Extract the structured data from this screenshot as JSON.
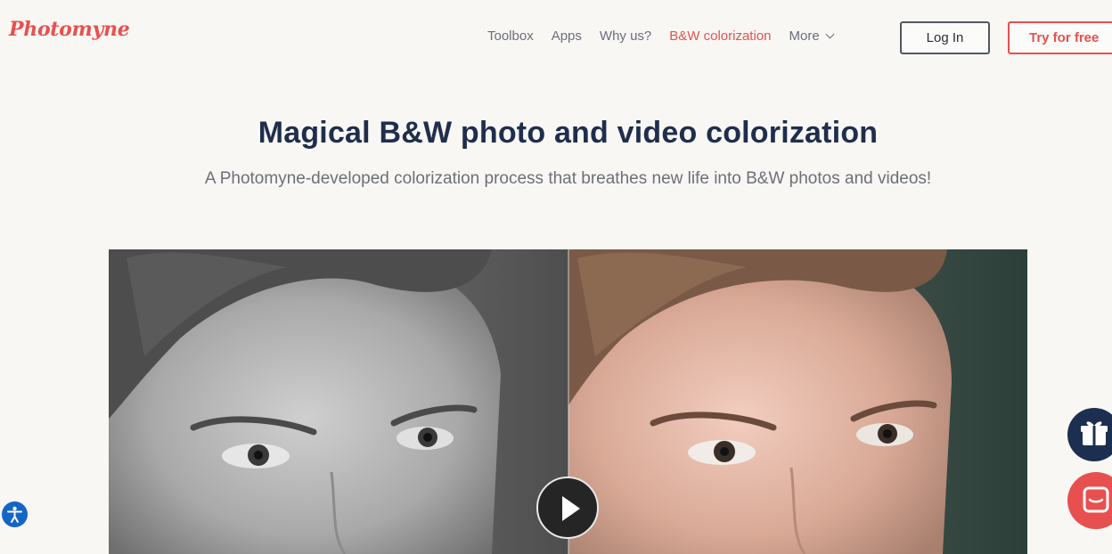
{
  "header": {
    "logo": "Photomyne",
    "nav": {
      "toolbox": "Toolbox",
      "apps": "Apps",
      "why_us": "Why us?",
      "colorization": "B&W colorization",
      "more": "More"
    },
    "login_label": "Log In",
    "try_label": "Try for free"
  },
  "hero": {
    "title": "Magical B&W photo and video colorization",
    "subtitle": "A Photomyne-developed colorization process that breathes new life into B&W photos and videos!"
  },
  "media": {
    "play_icon": "play-icon"
  },
  "widgets": {
    "accessibility_icon": "accessibility-icon",
    "gift_icon": "gift-box-icon",
    "chat_icon": "chat-icon"
  },
  "colors": {
    "brand": "#e8504f",
    "heading": "#1f2e4d",
    "accessibility": "#1565c7"
  }
}
